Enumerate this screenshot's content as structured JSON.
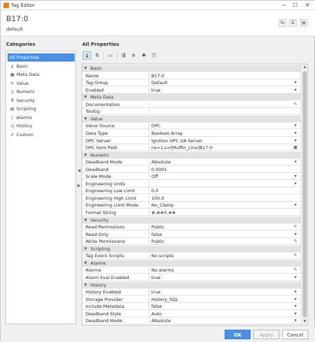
{
  "window": {
    "title": "Tag Editor",
    "controls": [
      "─",
      "☐",
      "✕"
    ]
  },
  "header": {
    "tag_name": "B17:0",
    "provider": "default",
    "buttons": [
      "fx",
      "☰",
      "▤"
    ]
  },
  "categories": {
    "title": "Categories",
    "items": [
      {
        "label": "All Properties",
        "icon": "list-icon",
        "glyph": ""
      },
      {
        "label": "Basic",
        "icon": "info-icon",
        "glyph": "ℹ"
      },
      {
        "label": "Meta Data",
        "icon": "meta-data-icon",
        "glyph": "▦"
      },
      {
        "label": "Value",
        "icon": "value-icon",
        "glyph": "✎"
      },
      {
        "label": "Numeric",
        "icon": "numeric-icon",
        "glyph": "▯"
      },
      {
        "label": "Security",
        "icon": "shield-icon",
        "glyph": "⛨"
      },
      {
        "label": "Scripting",
        "icon": "scripting-icon",
        "glyph": "▤"
      },
      {
        "label": "Alarms",
        "icon": "bell-icon",
        "glyph": "♪"
      },
      {
        "label": "History",
        "icon": "history-icon",
        "glyph": "◷"
      },
      {
        "label": "Custom",
        "icon": "wrench-icon",
        "glyph": "✐"
      }
    ]
  },
  "properties": {
    "title": "All Properties",
    "toolbar": [
      "↨",
      "⇅",
      "▭",
      "⇶",
      "≡",
      "✚",
      "🗑"
    ],
    "rows": [
      {
        "type": "section",
        "label": "Basic"
      },
      {
        "type": "prop",
        "name": "Name",
        "value": "B17:0",
        "ctrl": ""
      },
      {
        "type": "prop",
        "name": "Tag Group",
        "value": "Default",
        "ctrl": "▾"
      },
      {
        "type": "prop",
        "name": "Enabled",
        "value": "true",
        "ctrl": "▾"
      },
      {
        "type": "section",
        "label": "Meta Data"
      },
      {
        "type": "prop",
        "name": "Documentation",
        "value": "",
        "ctrl": "✎"
      },
      {
        "type": "prop",
        "name": "Tooltip",
        "value": "",
        "ctrl": ""
      },
      {
        "type": "section",
        "label": "Value"
      },
      {
        "type": "prop",
        "name": "Value Source",
        "value": "OPC",
        "ctrl": "▾"
      },
      {
        "type": "prop",
        "name": "Data Type",
        "value": "Boolean Array",
        "ctrl": "▾"
      },
      {
        "type": "prop",
        "name": "OPC Server",
        "value": "Ignition OPC UA Server",
        "ctrl": "▾"
      },
      {
        "type": "prop",
        "name": "OPC Item Path",
        "value": "ns=1;s=[Muffin_Line]B17:0",
        "ctrl": "▦"
      },
      {
        "type": "section",
        "label": "Numeric"
      },
      {
        "type": "prop",
        "name": "Deadband Mode",
        "value": "Absolute",
        "ctrl": "▾"
      },
      {
        "type": "prop",
        "name": "Deadband",
        "value": "0.0001",
        "ctrl": ""
      },
      {
        "type": "prop",
        "name": "Scale Mode",
        "value": "Off",
        "ctrl": "▾"
      },
      {
        "type": "prop",
        "name": "Engineering Units",
        "value": "",
        "ctrl": "▾"
      },
      {
        "type": "prop",
        "name": "Engineering Low Limit",
        "value": "0.0",
        "ctrl": ""
      },
      {
        "type": "prop",
        "name": "Engineering High Limit",
        "value": "100.0",
        "ctrl": ""
      },
      {
        "type": "prop",
        "name": "Engineering Limit Mode",
        "value": "No_Clamp",
        "ctrl": "▾"
      },
      {
        "type": "prop",
        "name": "Format String",
        "value": "#,##0.##",
        "ctrl": ""
      },
      {
        "type": "section",
        "label": "Security"
      },
      {
        "type": "prop",
        "name": "Read Permissions",
        "value": "Public",
        "ctrl": "✎"
      },
      {
        "type": "prop",
        "name": "Read Only",
        "value": "false",
        "ctrl": "▾"
      },
      {
        "type": "prop",
        "name": "Write Permissions",
        "value": "Public",
        "ctrl": "✎"
      },
      {
        "type": "section",
        "label": "Scripting"
      },
      {
        "type": "prop",
        "name": "Tag Event Scripts",
        "value": "No scripts",
        "ctrl": "✎"
      },
      {
        "type": "section",
        "label": "Alarms"
      },
      {
        "type": "prop",
        "name": "Alarms",
        "value": "No alarms",
        "ctrl": "✎"
      },
      {
        "type": "prop",
        "name": "Alarm Eval Enabled",
        "value": "true",
        "ctrl": "▾"
      },
      {
        "type": "section",
        "label": "History"
      },
      {
        "type": "prop",
        "name": "History Enabled",
        "value": "true",
        "ctrl": "▾"
      },
      {
        "type": "prop",
        "name": "Storage Provider",
        "value": "History_SQL",
        "ctrl": "▾"
      },
      {
        "type": "prop",
        "name": "Include Metadata",
        "value": "false",
        "ctrl": "▾"
      },
      {
        "type": "prop",
        "name": "Deadband Style",
        "value": "Auto",
        "ctrl": "▾"
      },
      {
        "type": "prop",
        "name": "Deadband Mode",
        "value": "Absolute",
        "ctrl": "▾"
      }
    ]
  },
  "footer": {
    "ok": "OK",
    "apply": "Apply",
    "cancel": "Cancel"
  }
}
